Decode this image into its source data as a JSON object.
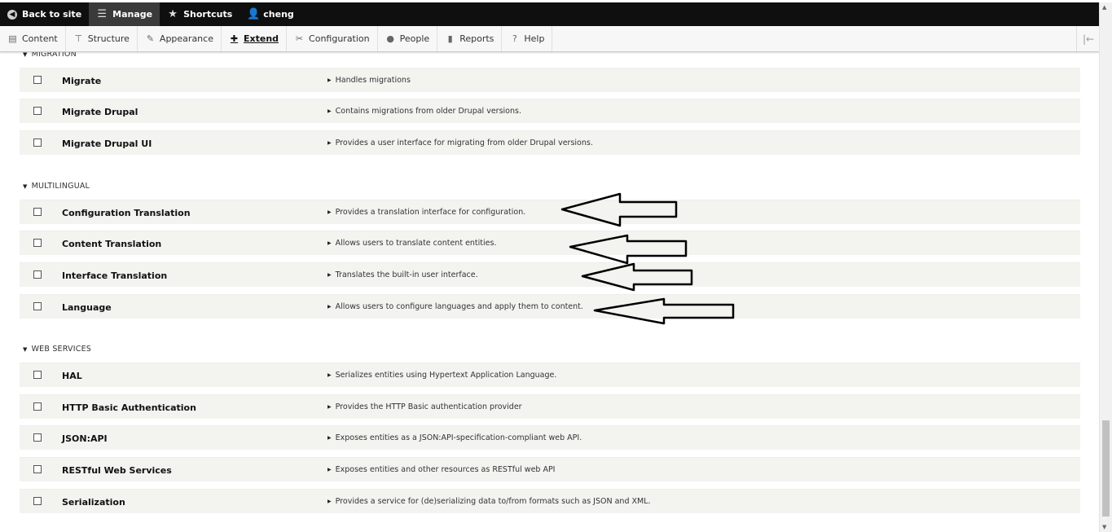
{
  "toolbar": {
    "back_to_site": "Back to site",
    "manage": "Manage",
    "shortcuts": "Shortcuts",
    "user": "cheng"
  },
  "admin_menu": {
    "items": [
      {
        "label": "Content",
        "icon": "file-icon"
      },
      {
        "label": "Structure",
        "icon": "sitemap-icon"
      },
      {
        "label": "Appearance",
        "icon": "paintbrush-icon"
      },
      {
        "label": "Extend",
        "icon": "puzzle-icon",
        "active": true
      },
      {
        "label": "Configuration",
        "icon": "wrench-icon"
      },
      {
        "label": "People",
        "icon": "people-icon"
      },
      {
        "label": "Reports",
        "icon": "chart-icon"
      },
      {
        "label": "Help",
        "icon": "help-icon"
      }
    ]
  },
  "groups": [
    {
      "title": "MIGRATION",
      "modules": [
        {
          "name": "Migrate",
          "description": "Handles migrations"
        },
        {
          "name": "Migrate Drupal",
          "description": "Contains migrations from older Drupal versions."
        },
        {
          "name": "Migrate Drupal UI",
          "description": "Provides a user interface for migrating from older Drupal versions."
        }
      ]
    },
    {
      "title": "MULTILINGUAL",
      "modules": [
        {
          "name": "Configuration Translation",
          "description": "Provides a translation interface for configuration."
        },
        {
          "name": "Content Translation",
          "description": "Allows users to translate content entities."
        },
        {
          "name": "Interface Translation",
          "description": "Translates the built-in user interface."
        },
        {
          "name": "Language",
          "description": "Allows users to configure languages and apply them to content."
        }
      ]
    },
    {
      "title": "WEB SERVICES",
      "modules": [
        {
          "name": "HAL",
          "description": "Serializes entities using Hypertext Application Language."
        },
        {
          "name": "HTTP Basic Authentication",
          "description": "Provides the HTTP Basic authentication provider"
        },
        {
          "name": "JSON:API",
          "description": "Exposes entities as a JSON:API-specification-compliant web API."
        },
        {
          "name": "RESTful Web Services",
          "description": "Exposes entities and other resources as RESTful web API"
        },
        {
          "name": "Serialization",
          "description": "Provides a service for (de)serializing data to/from formats such as JSON and XML."
        }
      ]
    }
  ]
}
